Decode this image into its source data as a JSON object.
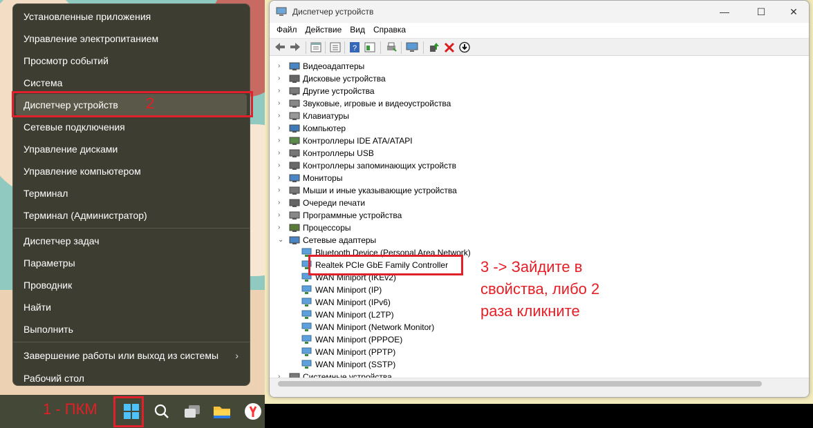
{
  "winx_menu": {
    "items": [
      {
        "label": "Установленные приложения"
      },
      {
        "label": "Управление электропитанием"
      },
      {
        "label": "Просмотр событий"
      },
      {
        "label": "Система"
      },
      {
        "label": "Диспетчер устройств"
      },
      {
        "label": "Сетевые подключения"
      },
      {
        "label": "Управление дисками"
      },
      {
        "label": "Управление компьютером"
      },
      {
        "label": "Терминал"
      },
      {
        "label": "Терминал (Администратор)"
      },
      {
        "label": "Диспетчер задач"
      },
      {
        "label": "Параметры"
      },
      {
        "label": "Проводник"
      },
      {
        "label": "Найти"
      },
      {
        "label": "Выполнить"
      },
      {
        "label": "Завершение работы или выход из системы"
      },
      {
        "label": "Рабочий стол"
      }
    ],
    "submenu_chevron": "›"
  },
  "annotations": {
    "step1": "1 - ПКМ",
    "step2": "2",
    "step3_line1": "3 -> Зайдите в",
    "step3_line2": "свойства, либо 2",
    "step3_line3": "раза кликните",
    "color": "#e41e26"
  },
  "window": {
    "title": "Диспетчер устройств",
    "controls": {
      "minimize": "—",
      "maximize": "☐",
      "close": "✕"
    }
  },
  "menubar": [
    "Файл",
    "Действие",
    "Вид",
    "Справка"
  ],
  "toolbar_icons": [
    "back-icon",
    "forward-icon",
    "properties-icon",
    "scan-icon",
    "help-icon",
    "show-hidden-icon",
    "print-icon",
    "monitor-icon",
    "update-driver-icon",
    "uninstall-icon",
    "disable-icon"
  ],
  "tree": {
    "categories": [
      {
        "label": "Видеоадаптеры"
      },
      {
        "label": "Дисковые устройства"
      },
      {
        "label": "Другие устройства"
      },
      {
        "label": "Звуковые, игровые и видеоустройства"
      },
      {
        "label": "Клавиатуры"
      },
      {
        "label": "Компьютер"
      },
      {
        "label": "Контроллеры IDE ATA/ATAPI"
      },
      {
        "label": "Контроллеры USB"
      },
      {
        "label": "Контроллеры запоминающих устройств"
      },
      {
        "label": "Мониторы"
      },
      {
        "label": "Мыши и иные указывающие устройства"
      },
      {
        "label": "Очереди печати"
      },
      {
        "label": "Программные устройства"
      },
      {
        "label": "Процессоры"
      }
    ],
    "network_category": "Сетевые адаптеры",
    "network_adapters": [
      {
        "label": "Bluetooth Device (Personal Area Network)"
      },
      {
        "label": "Realtek PCIe GbE Family Controller"
      },
      {
        "label": "WAN Miniport (IKEv2)"
      },
      {
        "label": "WAN Miniport (IP)"
      },
      {
        "label": "WAN Miniport (IPv6)"
      },
      {
        "label": "WAN Miniport (L2TP)"
      },
      {
        "label": "WAN Miniport (Network Monitor)"
      },
      {
        "label": "WAN Miniport (PPPOE)"
      },
      {
        "label": "WAN Miniport (PPTP)"
      },
      {
        "label": "WAN Miniport (SSTP)"
      }
    ],
    "last_category": "Системные устройства"
  },
  "taskbar_icons": [
    "start-icon",
    "search-icon",
    "task-view-icon",
    "file-explorer-icon",
    "yandex-browser-icon"
  ]
}
